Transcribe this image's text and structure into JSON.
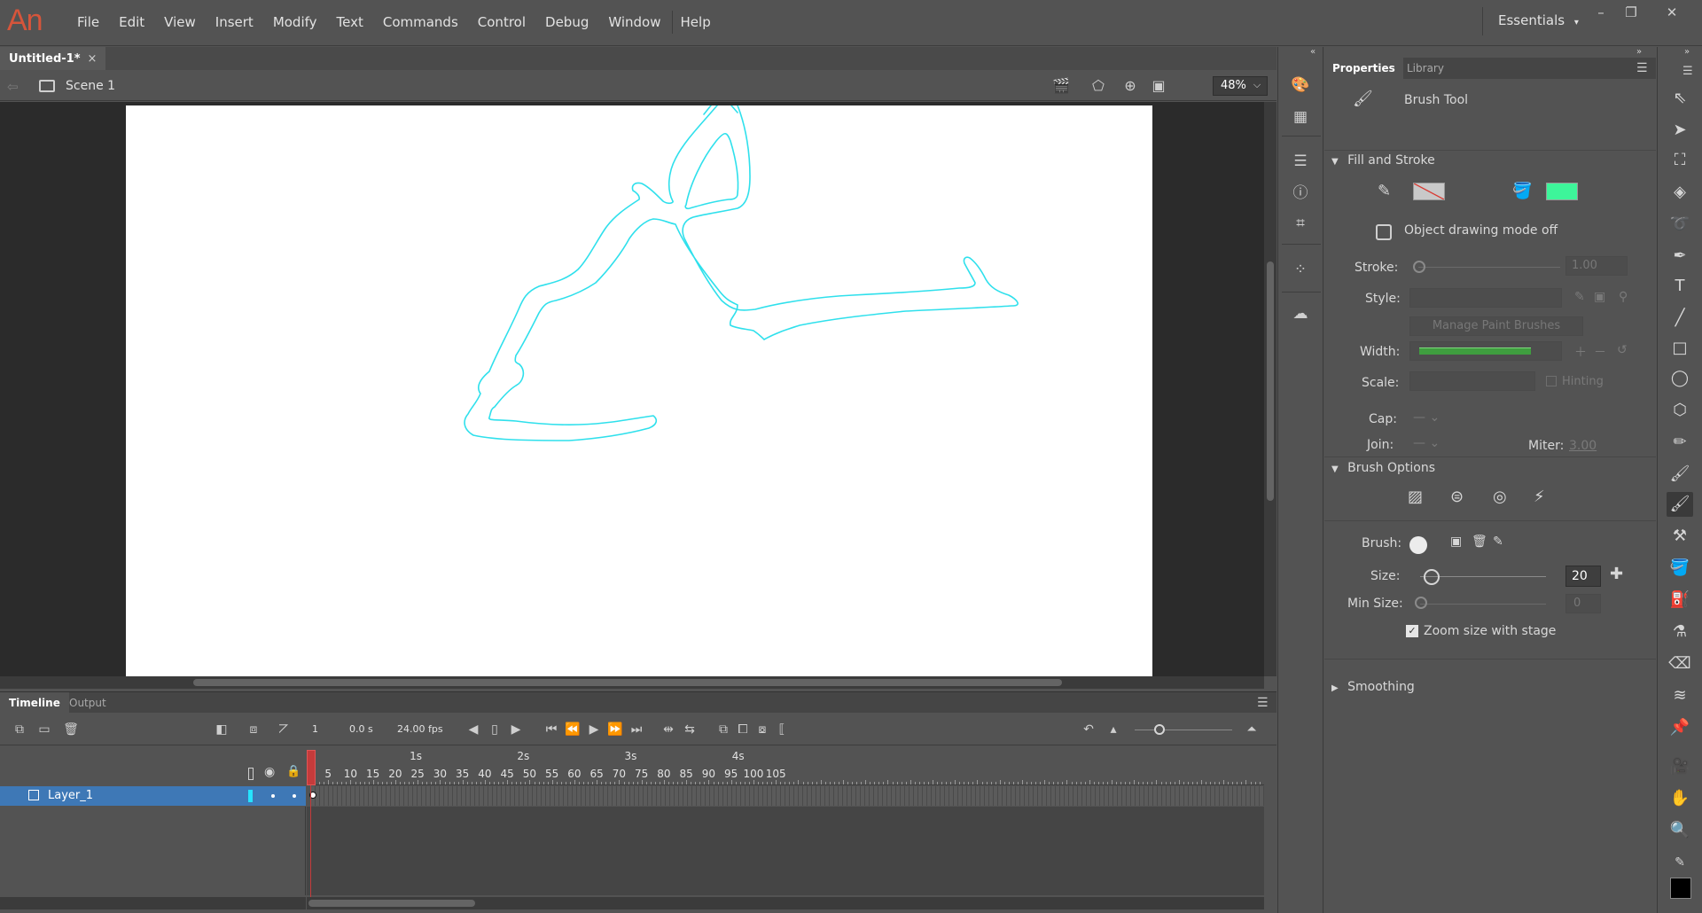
{
  "app": {
    "logo_text": "An"
  },
  "menu": [
    "File",
    "Edit",
    "View",
    "Insert",
    "Modify",
    "Text",
    "Commands",
    "Control",
    "Debug",
    "Window",
    "Help"
  ],
  "workspace": {
    "label": "Essentials",
    "arrow": "▾"
  },
  "window_controls": {
    "minimize": "–",
    "restore": "❐",
    "close": "✕"
  },
  "document": {
    "tab_title": "Untitled-1*",
    "close_glyph": "×"
  },
  "editbar": {
    "scene_label": "Scene 1",
    "zoom": "48%",
    "zoom_arrow": "⌵"
  },
  "timeline": {
    "tabs": [
      "Timeline",
      "Output"
    ],
    "current_frame": "1",
    "time": "0.0 s",
    "fps": "24.00 fps",
    "seconds_labels": [
      {
        "label": "1s",
        "frame": 24
      },
      {
        "label": "2s",
        "frame": 48
      },
      {
        "label": "3s",
        "frame": 72
      },
      {
        "label": "4s",
        "frame": 96
      }
    ],
    "frame_labels": [
      "1",
      "5",
      "10",
      "15",
      "20",
      "25",
      "30",
      "35",
      "40",
      "45",
      "50",
      "55",
      "60",
      "65",
      "70",
      "75",
      "80",
      "85",
      "90",
      "95",
      "100",
      "105"
    ],
    "layer": {
      "name": "Layer_1",
      "color": "#26e3ff"
    }
  },
  "properties": {
    "tabs": [
      "Properties",
      "Library"
    ],
    "tool_name": "Brush Tool",
    "fill_stroke": {
      "header": "Fill and Stroke",
      "fill_color": "#3df59a",
      "object_drawing": "Object drawing mode off",
      "stroke_label": "Stroke:",
      "stroke_value": "1.00",
      "style_label": "Style:",
      "manage_brushes": "Manage Paint Brushes",
      "width_label": "Width:",
      "scale_label": "Scale:",
      "hinting_label": "Hinting",
      "cap_label": "Cap:",
      "join_label": "Join:",
      "miter_label": "Miter:",
      "miter_value": "3.00"
    },
    "brush_options": {
      "header": "Brush Options",
      "brush_label": "Brush:",
      "size_label": "Size:",
      "size_value": "20",
      "size_fraction": 0.05,
      "min_size_label": "Min Size:",
      "min_size_value": "0",
      "zoom_with_stage": "Zoom size with stage"
    },
    "smoothing": {
      "header": "Smoothing"
    }
  },
  "colors": {
    "stroke_path": "#2fe0ec",
    "stage_bg": "#ffffff",
    "layer_selected": "#3e78b6",
    "playhead": "#c53b3b"
  }
}
